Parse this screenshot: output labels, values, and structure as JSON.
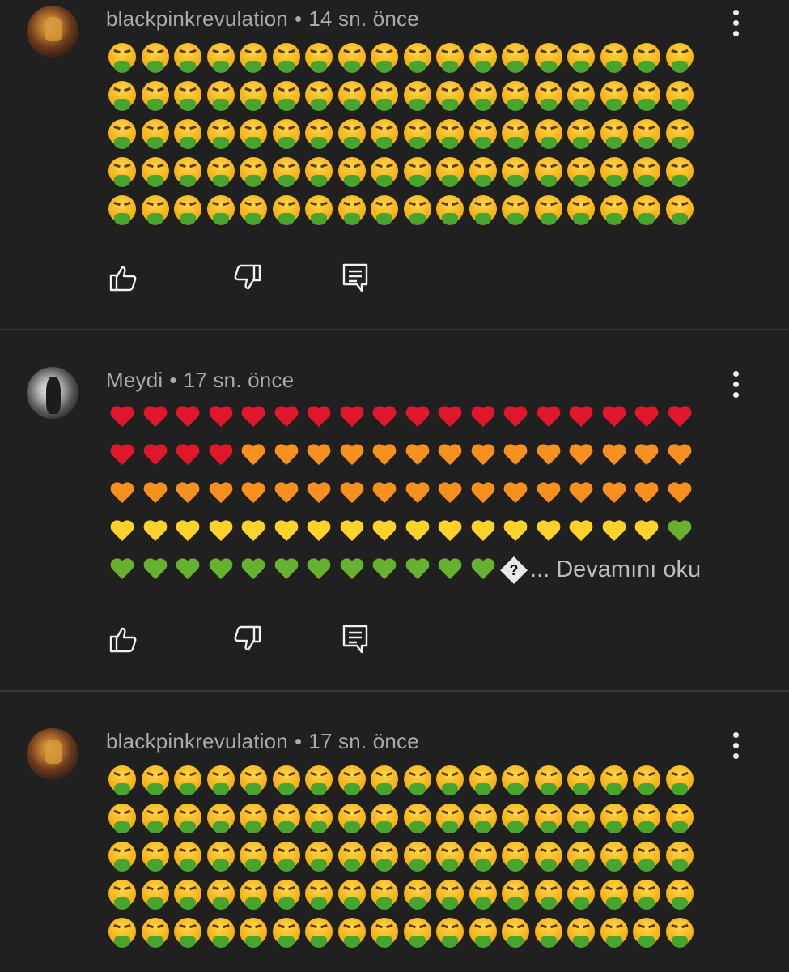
{
  "comments": [
    {
      "author": "blackpinkrevulation",
      "separator": "•",
      "time": "14 sn. önce",
      "avatar_icon": "user-avatar",
      "emoji_rows": [
        {
          "emoji": "face-vomiting",
          "count": 18
        },
        {
          "emoji": "face-vomiting",
          "count": 18
        },
        {
          "emoji": "face-vomiting",
          "count": 18
        },
        {
          "emoji": "face-vomiting",
          "count": 18
        },
        {
          "emoji": "face-vomiting",
          "count": 18
        }
      ],
      "actions": [
        "thumbs-up-icon",
        "thumbs-down-icon",
        "reply-icon"
      ]
    },
    {
      "author": "Meydi",
      "separator": "•",
      "time": "17 sn. önce",
      "avatar_icon": "user-avatar",
      "emoji_rows": [
        {
          "segments": [
            {
              "emoji": "red-heart",
              "count": 18
            }
          ]
        },
        {
          "segments": [
            {
              "emoji": "red-heart",
              "count": 4
            },
            {
              "emoji": "orange-heart",
              "count": 14
            }
          ]
        },
        {
          "segments": [
            {
              "emoji": "orange-heart",
              "count": 18
            }
          ]
        },
        {
          "segments": [
            {
              "emoji": "yellow-heart",
              "count": 17
            },
            {
              "emoji": "green-heart",
              "count": 1
            }
          ]
        },
        {
          "segments": [
            {
              "emoji": "green-heart",
              "count": 12
            }
          ]
        }
      ],
      "truncation_glyph": "?",
      "ellipsis": "...",
      "read_more": "Devamını oku",
      "actions": [
        "thumbs-up-icon",
        "thumbs-down-icon",
        "reply-icon"
      ]
    },
    {
      "author": "blackpinkrevulation",
      "separator": "•",
      "time": "17 sn. önce",
      "avatar_icon": "user-avatar",
      "emoji_rows": [
        {
          "emoji": "face-vomiting",
          "count": 18
        },
        {
          "emoji": "face-vomiting",
          "count": 18
        },
        {
          "emoji": "face-vomiting",
          "count": 18
        },
        {
          "emoji": "face-vomiting",
          "count": 18
        },
        {
          "emoji": "face-vomiting",
          "count": 18
        }
      ]
    }
  ],
  "colors": {
    "background": "#202020",
    "divider": "#3a3a3a",
    "meta_text": "#aaaaaa",
    "red_heart": "#e0172b",
    "orange_heart": "#f7901e",
    "yellow_heart": "#fcd22b",
    "green_heart": "#68b030"
  },
  "menu_icon": "more-vertical-icon"
}
